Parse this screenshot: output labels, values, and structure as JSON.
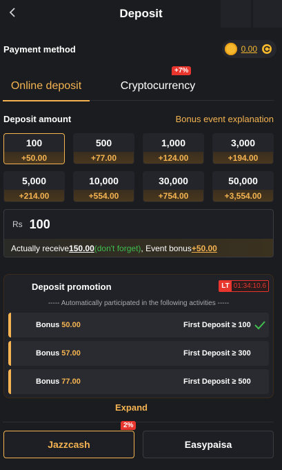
{
  "header": {
    "title": "Deposit",
    "back_icon": "chevron-left-icon"
  },
  "payment_method": {
    "label": "Payment method",
    "balance": "0.00",
    "coin_icon": "coin-icon",
    "refresh_icon": "refresh-icon"
  },
  "tabs": [
    {
      "label": "Online deposit",
      "active": true
    },
    {
      "label": "Cryptocurrency",
      "badge": "+7%"
    }
  ],
  "deposit_amount": {
    "label": "Deposit amount",
    "bonus_link": "Bonus event explanation",
    "options": [
      {
        "amount": "100",
        "bonus": "+50.00",
        "selected": true
      },
      {
        "amount": "500",
        "bonus": "+77.00"
      },
      {
        "amount": "1,000",
        "bonus": "+124.00"
      },
      {
        "amount": "3,000",
        "bonus": "+194.00"
      },
      {
        "amount": "5,000",
        "bonus": "+214.00"
      },
      {
        "amount": "10,000",
        "bonus": "+554.00"
      },
      {
        "amount": "30,000",
        "bonus": "+754.00"
      },
      {
        "amount": "50,000",
        "bonus": "+3,554.00"
      }
    ]
  },
  "amount_input": {
    "currency": "Rs",
    "value": "100",
    "receive_prefix": "Actually receive ",
    "receive_amount": "150.00",
    "receive_note": "(don't forget)",
    "receive_mid": ", Event bonus ",
    "event_bonus": "+50.00"
  },
  "promotion": {
    "title": "Deposit promotion",
    "timer_tag": "LT",
    "timer": "01:34:10.6",
    "subtitle": "----- Automatically participated in the following activities -----",
    "items": [
      {
        "bonus_label": "Bonus ",
        "bonus_value": "50.00",
        "condition": "First Deposit ≥ 100",
        "checked": true
      },
      {
        "bonus_label": "Bonus ",
        "bonus_value": "57.00",
        "condition": "First Deposit ≥ 300",
        "checked": false
      },
      {
        "bonus_label": "Bonus ",
        "bonus_value": "77.00",
        "condition": "First Deposit ≥ 500",
        "checked": false
      }
    ],
    "expand_label": "Expand"
  },
  "payment_channels": [
    {
      "label": "Jazzcash",
      "badge": "2%",
      "selected": true
    },
    {
      "label": "Easypaisa"
    }
  ],
  "colors": {
    "accent": "#f5b451",
    "background": "#1b1c20",
    "badge_red": "#e8362f",
    "success_green": "#3fbf4f"
  }
}
